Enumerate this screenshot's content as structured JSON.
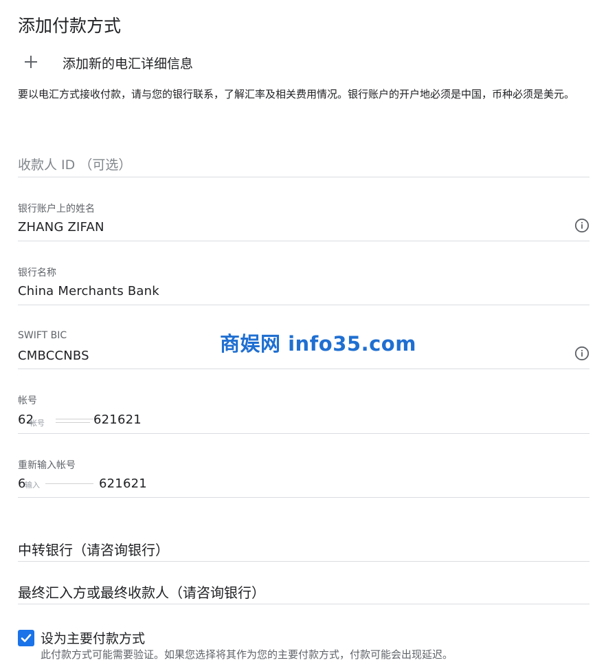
{
  "header": {
    "title": "添加付款方式"
  },
  "add_wire": {
    "label": "添加新的电汇详细信息",
    "icon": "plus-icon"
  },
  "description": "要以电汇方式接收付款，请与您的银行联系，了解汇率及相关费用情况。银行账户的开户地必须是中国，币种必须是美元。",
  "fields": {
    "payee_id": {
      "placeholder": "收款人 ID （可选）"
    },
    "account_name": {
      "label": "银行账户上的姓名",
      "value": "ZHANG ZIFAN",
      "icon": "info-icon"
    },
    "bank_name": {
      "label": "银行名称",
      "value": "China Merchants Bank"
    },
    "swift_bic": {
      "label": "SWIFT BIC",
      "value": "CMBCCNBS",
      "icon": "info-icon"
    },
    "account_number": {
      "label": "帐号",
      "value_start": "62",
      "value_end": "621621",
      "ghost_text": "帐号"
    },
    "account_number_confirm": {
      "label": "重新输入帐号",
      "value_start": "6",
      "value_end": "621621",
      "ghost_text": "输入"
    }
  },
  "sections": {
    "intermediary_bank": "中转银行（请咨询银行）",
    "final_beneficiary": "最终汇入方或最终收款人（请咨询银行）"
  },
  "primary": {
    "label": "设为主要付款方式",
    "checked": true,
    "help": "此付款方式可能需要验证。如果您选择将其作为您的主要付款方式，付款可能会出现延迟。"
  },
  "watermark": {
    "text": "商娱网 info35.com",
    "color": "#1f6fd1"
  },
  "colors": {
    "accent": "#1a73e8",
    "divider": "#dadce0",
    "label": "#5f6368"
  }
}
